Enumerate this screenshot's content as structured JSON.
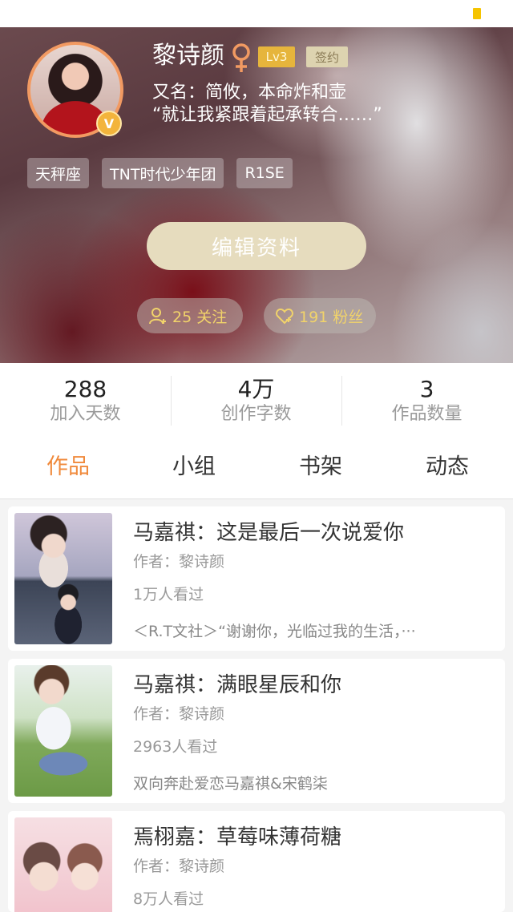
{
  "colors": {
    "accent_orange": "#f08a3c",
    "level_badge": "#e6b53c",
    "fans_text": "#f1d36a",
    "edit_button": "#e6dcbe"
  },
  "profile": {
    "name": "黎诗颜",
    "gender_icon": "female-icon",
    "level": "Lv3",
    "signed": "签约",
    "alias": "又名：简攸，本命炸和壶",
    "quote": "“就让我紧跟着起承转合……”",
    "verified_badge": "V",
    "tags": [
      "天秤座",
      "TNT时代少年团",
      "R1SE"
    ],
    "edit_label": "编辑资料",
    "follow_label": "25 关注",
    "fans_label": "191 粉丝"
  },
  "stats": [
    {
      "value": "288",
      "label": "加入天数"
    },
    {
      "value": "4万",
      "label": "创作字数"
    },
    {
      "value": "3",
      "label": "作品数量"
    }
  ],
  "tabs": [
    "作品",
    "小组",
    "书架",
    "动态"
  ],
  "works": [
    {
      "title": "马嘉祺：这是最后一次说爱你",
      "author": "作者：黎诗颜",
      "views": "1万人看过",
      "desc": "＜R.T文社＞“谢谢你，光临过我的生活，···"
    },
    {
      "title": "马嘉祺：满眼星辰和你",
      "author": "作者：黎诗颜",
      "views": "2963人看过",
      "desc": "双向奔赴爱恋马嘉祺&宋鹤柒"
    },
    {
      "title": "焉栩嘉：草莓味薄荷糖",
      "author": "作者：黎诗颜",
      "views": "8万人看过",
      "desc": ""
    }
  ]
}
